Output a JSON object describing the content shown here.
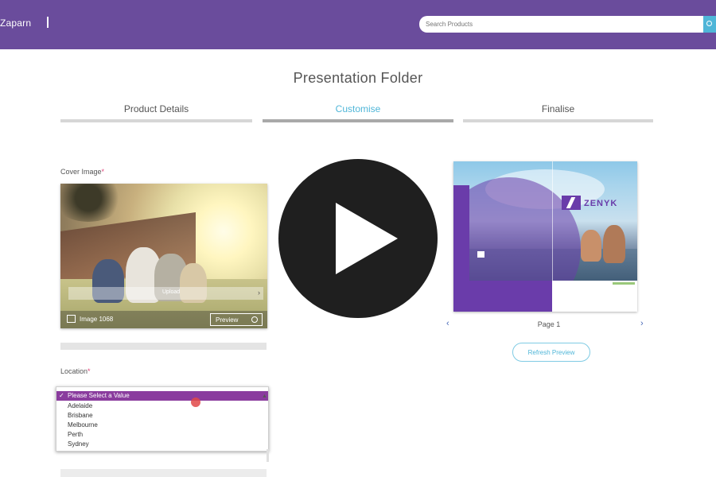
{
  "header": {
    "brand": "Zaparn",
    "search_placeholder": "Search Products"
  },
  "page": {
    "title": "Presentation Folder"
  },
  "tabs": [
    {
      "label": "Product Details",
      "active": false
    },
    {
      "label": "Customise",
      "active": true
    },
    {
      "label": "Finalise",
      "active": false
    }
  ],
  "cover": {
    "label": "Cover Image",
    "required_mark": "*",
    "overlay_text": "Upload",
    "footer_text": "Image 1068",
    "preview_label": "Preview"
  },
  "location": {
    "label": "Location",
    "required_mark": "*",
    "options": [
      {
        "label": "Please Select a Value",
        "selected": true
      },
      {
        "label": "Adelaide",
        "selected": false
      },
      {
        "label": "Brisbane",
        "selected": false
      },
      {
        "label": "Melbourne",
        "selected": false
      },
      {
        "label": "Perth",
        "selected": false
      },
      {
        "label": "Sydney",
        "selected": false
      }
    ]
  },
  "preview": {
    "logo_text": "ZENYK",
    "page_label": "Page 1",
    "refresh_label": "Refresh Preview"
  },
  "video": {
    "play_icon": "play-icon"
  },
  "colors": {
    "header": "#6a4c9c",
    "accent": "#4fb6d8",
    "dropdown_selected": "#8a3c9e",
    "brand_purple": "#6a3caa"
  }
}
